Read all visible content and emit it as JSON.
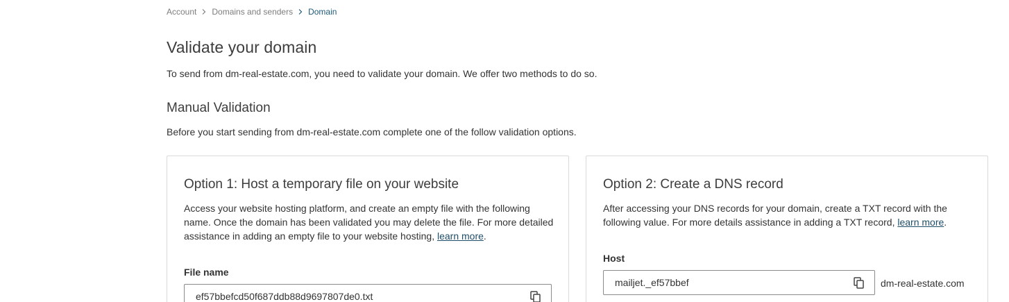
{
  "breadcrumb": {
    "items": [
      "Account",
      "Domains and senders"
    ],
    "current": "Domain"
  },
  "page": {
    "title": "Validate your domain",
    "intro": "To send from dm-real-estate.com, you need to validate your domain. We offer two methods to do so."
  },
  "manual": {
    "title": "Manual Validation",
    "description": "Before you start sending from dm-real-estate.com complete one of the follow validation options."
  },
  "option1": {
    "title": "Option 1: Host a temporary file on your website",
    "text": "Access your website hosting platform, and create an empty file with the following name. Once the domain has been validated you may delete the file. For more detailed assistance in adding an empty file to your website hosting, ",
    "link": "learn more",
    "text_end": ".",
    "field_label": "File name",
    "field_value": "ef57bbefcd50f687ddb88d9697807de0.txt"
  },
  "option2": {
    "title": "Option 2: Create a DNS record",
    "text": "After accessing your DNS records for your domain, create a TXT record with the following value. For more details assistance in adding a TXT record, ",
    "link": "learn more",
    "text_end": ".",
    "field_label": "Host",
    "field_value": "mailjet._ef57bbef",
    "suffix": "dm-real-estate.com"
  },
  "colors": {
    "link": "#1f4e6b",
    "breadcrumb_current": "#1f5a7a",
    "border": "#dadada"
  }
}
